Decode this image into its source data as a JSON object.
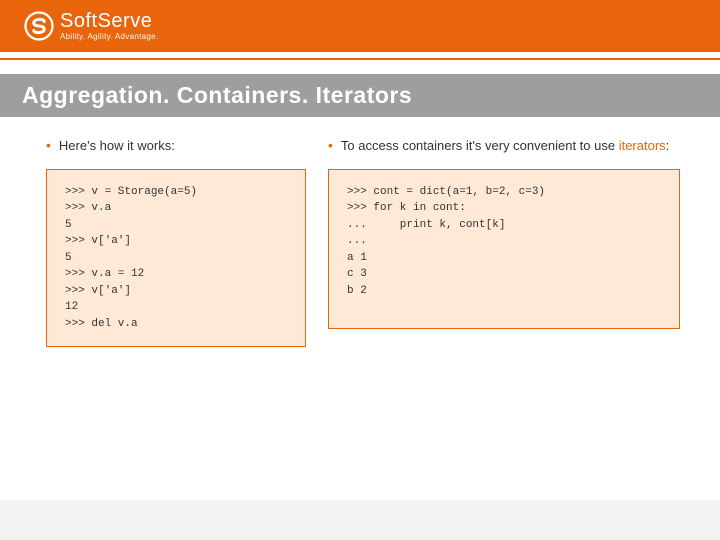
{
  "brand": {
    "name_soft": "Soft",
    "name_serve": "Serve",
    "tagline": "Ability. Agility. Advantage."
  },
  "title": "Aggregation.  Containers.  Iterators",
  "left": {
    "bullet": "Here's how it works:",
    "code": ">>> v = Storage(a=5)\n>>> v.a\n5\n>>> v['a']\n5\n>>> v.a = 12\n>>> v['a']\n12\n>>> del v.a"
  },
  "right": {
    "bullet_pre": "To access containers it's very convenient to use ",
    "bullet_hl": "iterators",
    "bullet_post": ":",
    "code": ">>> cont = dict(a=1, b=2, c=3)\n>>> for k in cont:\n...     print k, cont[k]\n...\na 1\nc 3\nb 2"
  }
}
